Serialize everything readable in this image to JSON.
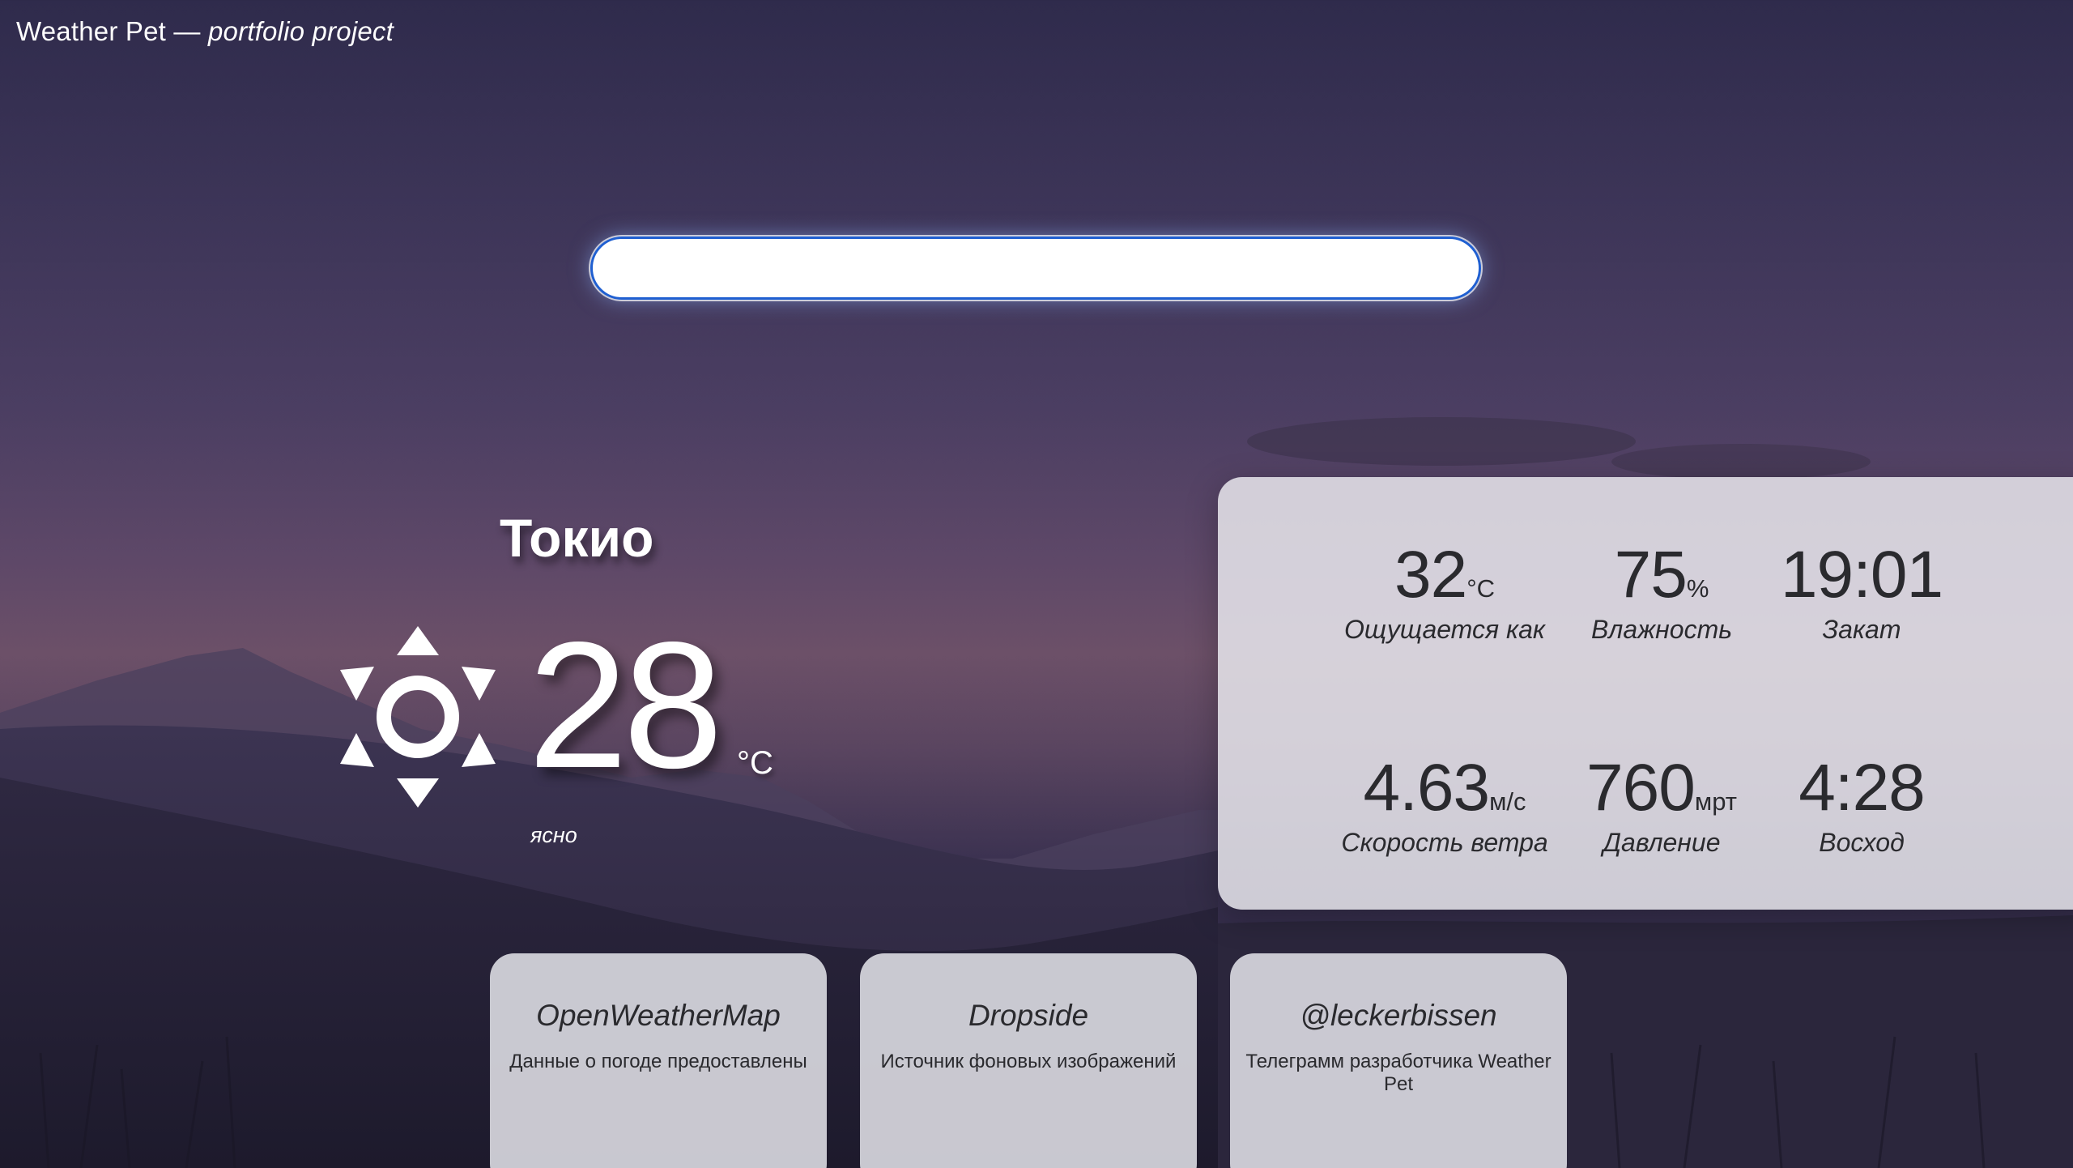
{
  "site": {
    "title": "Weather Pet —",
    "subtitle": "portfolio project"
  },
  "search": {
    "value": "",
    "placeholder": ""
  },
  "weather": {
    "city": "Токио",
    "temperature": "28",
    "temperature_unit": "°C",
    "condition": "ясно",
    "icon": "sun-icon"
  },
  "details": {
    "feels_like": {
      "value": "32",
      "unit": "°C",
      "label": "Ощущается как"
    },
    "humidity": {
      "value": "75",
      "unit": "%",
      "label": "Влажность"
    },
    "sunset": {
      "value": "19:01",
      "label": "Закат"
    },
    "wind": {
      "value": "4.63",
      "unit": "м/с",
      "label": "Скорость ветра"
    },
    "pressure": {
      "value": "760",
      "unit": "мрт",
      "label": "Давление"
    },
    "sunrise": {
      "value": "4:28",
      "label": "Восход"
    }
  },
  "credits": [
    {
      "title": "OpenWeatherMap",
      "description": "Данные о погоде предоставлены"
    },
    {
      "title": "Dropside",
      "description": "Источник фоновых изображений"
    },
    {
      "title": "@leckerbissen",
      "description": "Телеграмм разработчика Weather Pet"
    }
  ],
  "colors": {
    "search_border": "#1f5fd1",
    "panel_bg": "#e8e6ec",
    "text_dark": "#2a2a2e",
    "text_light": "#ffffff"
  }
}
